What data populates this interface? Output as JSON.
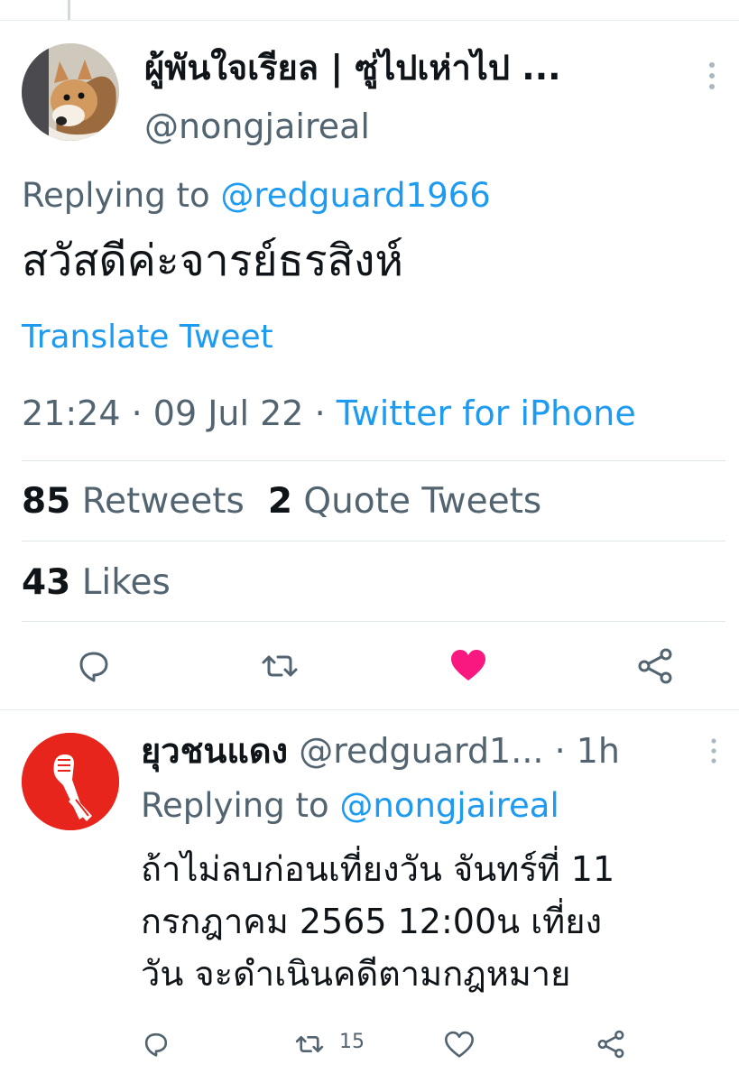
{
  "main_tweet": {
    "author_name": "ผู้พันใจเรียล | ซู่ไปเห่าไป ...",
    "author_handle": "@nongjaireal",
    "replying_label": "Replying to ",
    "replying_handle": "@redguard1966",
    "text": "สวัสดีค่ะจารย์ธรสิงห์",
    "translate_label": "Translate Tweet",
    "time": "21:24",
    "date": "09 Jul 22",
    "separator": " · ",
    "source": "Twitter for iPhone",
    "retweets_count": "85",
    "retweets_label": "Retweets",
    "quotes_count": "2",
    "quotes_label": "Quote Tweets",
    "likes_count": "43",
    "likes_label": "Likes",
    "liked": true,
    "icons": [
      "reply-icon",
      "retweet-icon",
      "like-icon",
      "share-icon"
    ]
  },
  "reply_tweet": {
    "author_name": "ยุวชนแดง",
    "author_handle": "@redguard1...",
    "time_ago": "· 1h",
    "replying_label": "Replying to ",
    "replying_handle": "@nongjaireal",
    "text_lines": [
      "ถ้าไม่ลบก่อนเที่ยงวัน จันทร์ที่ 11",
      "กรกฎาคม 2565 12:00น เที่ยง",
      "วัน จะดำเนินคดีตามกฎหมาย"
    ],
    "retweet_count": "15",
    "icons": [
      "reply-icon",
      "retweet-icon",
      "like-icon",
      "share-icon"
    ]
  },
  "colors": {
    "accent": "#1d9bf0",
    "like": "#f91880",
    "secondary_text": "#536471",
    "primary_text": "#0f1419",
    "reply_avatar_bg": "#e8251d"
  }
}
